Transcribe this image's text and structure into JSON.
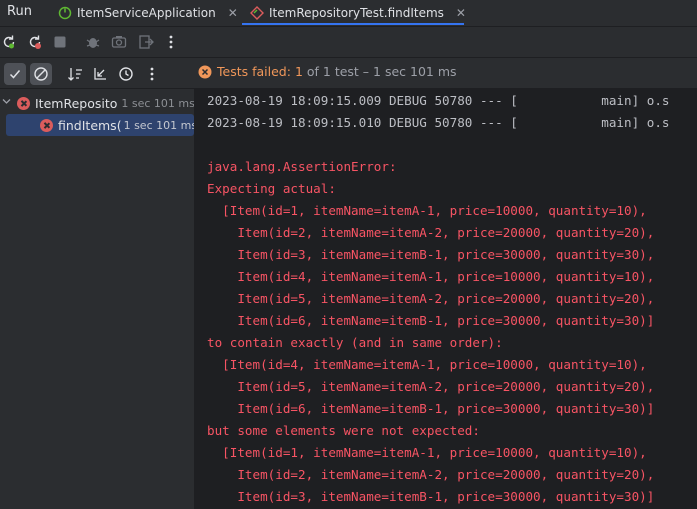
{
  "tabbar": {
    "run_label": "Run",
    "tabs": [
      {
        "label": "ItemServiceApplication",
        "icon": "spring-boot-icon"
      },
      {
        "label": "ItemRepositoryTest.findItems",
        "icon": "test-diamond-icon"
      }
    ]
  },
  "toolbar": {
    "icons": [
      "rerun-icon",
      "rerun-failed-icon",
      "stop-icon",
      "debug-icon",
      "camera-icon",
      "exit-icon",
      "more-vert-icon"
    ]
  },
  "toolbar2": {
    "icons": [
      "show-passed-icon",
      "show-ignored-icon",
      "sort-icon",
      "collapse-icon",
      "clock-icon",
      "more-vert-icon"
    ]
  },
  "status": {
    "label": "Tests failed:",
    "failed": "1",
    "rest": "of 1 test – 1 sec 101 ms"
  },
  "tree": {
    "root": {
      "name": "ItemReposito",
      "time": "1 sec 101 ms"
    },
    "child": {
      "name": "findItems(",
      "time": "1 sec 101 ms"
    }
  },
  "console": {
    "lines": [
      {
        "text": "2023-08-19 18:09:15.009 DEBUG 50780 --- [           main] o.s",
        "kind": "log"
      },
      {
        "text": "2023-08-19 18:09:15.010 DEBUG 50780 --- [           main] o.s",
        "kind": "log"
      },
      {
        "text": "",
        "kind": "log"
      },
      {
        "text": "java.lang.AssertionError:",
        "kind": "err"
      },
      {
        "text": "Expecting actual:",
        "kind": "err"
      },
      {
        "text": "  [Item(id=1, itemName=itemA-1, price=10000, quantity=10),",
        "kind": "err"
      },
      {
        "text": "    Item(id=2, itemName=itemA-2, price=20000, quantity=20),",
        "kind": "err"
      },
      {
        "text": "    Item(id=3, itemName=itemB-1, price=30000, quantity=30),",
        "kind": "err"
      },
      {
        "text": "    Item(id=4, itemName=itemA-1, price=10000, quantity=10),",
        "kind": "err"
      },
      {
        "text": "    Item(id=5, itemName=itemA-2, price=20000, quantity=20),",
        "kind": "err"
      },
      {
        "text": "    Item(id=6, itemName=itemB-1, price=30000, quantity=30)]",
        "kind": "err"
      },
      {
        "text": "to contain exactly (and in same order):",
        "kind": "err"
      },
      {
        "text": "  [Item(id=4, itemName=itemA-1, price=10000, quantity=10),",
        "kind": "err"
      },
      {
        "text": "    Item(id=5, itemName=itemA-2, price=20000, quantity=20),",
        "kind": "err"
      },
      {
        "text": "    Item(id=6, itemName=itemB-1, price=30000, quantity=30)]",
        "kind": "err"
      },
      {
        "text": "but some elements were not expected:",
        "kind": "err"
      },
      {
        "text": "  [Item(id=1, itemName=itemA-1, price=10000, quantity=10),",
        "kind": "err"
      },
      {
        "text": "    Item(id=2, itemName=itemA-2, price=20000, quantity=20),",
        "kind": "err"
      },
      {
        "text": "    Item(id=3, itemName=itemB-1, price=30000, quantity=30)]",
        "kind": "err"
      }
    ]
  },
  "colors": {
    "accent": "#3574f0",
    "error": "#f75464",
    "status_warn": "#f0975a",
    "selection": "#2e436e"
  }
}
